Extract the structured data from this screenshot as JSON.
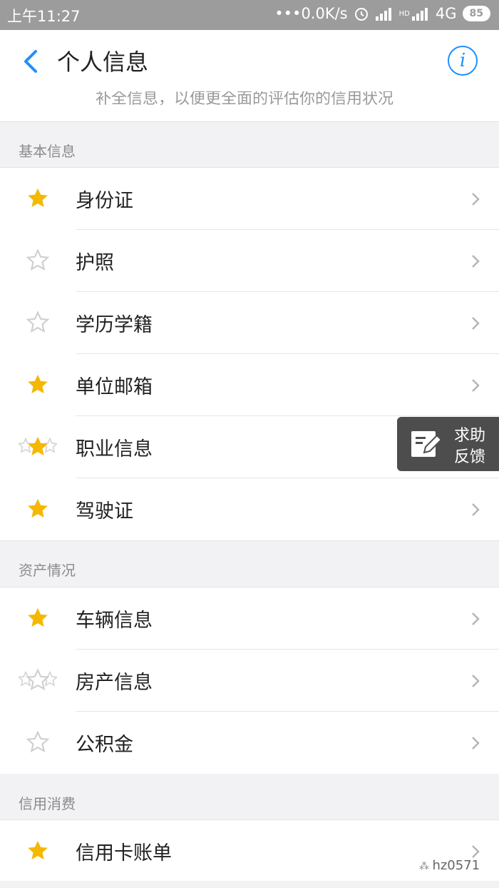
{
  "status": {
    "time": "上午11:27",
    "network": "•••0.0K/s",
    "signal_text": "4G",
    "hd": "HD",
    "battery": "85"
  },
  "nav": {
    "title": "个人信息",
    "info_icon": "info-icon"
  },
  "hint": "补全信息，以便更全面的评估你的信用状况",
  "sections": [
    {
      "label": "基本信息",
      "items": [
        {
          "label": "身份证",
          "star": "filled"
        },
        {
          "label": "护照",
          "star": "empty"
        },
        {
          "label": "学历学籍",
          "star": "empty"
        },
        {
          "label": "单位邮箱",
          "star": "filled"
        },
        {
          "label": "职业信息",
          "star": "multi-filled"
        },
        {
          "label": "驾驶证",
          "star": "filled"
        }
      ]
    },
    {
      "label": "资产情况",
      "items": [
        {
          "label": "车辆信息",
          "star": "filled"
        },
        {
          "label": "房产信息",
          "star": "multi-empty"
        },
        {
          "label": "公积金",
          "star": "empty"
        }
      ]
    },
    {
      "label": "信用消费",
      "items": [
        {
          "label": "信用卡账单",
          "star": "filled"
        }
      ]
    }
  ],
  "fab": {
    "line1": "求助",
    "line2": "反馈"
  },
  "watermark": "hz0571",
  "colors": {
    "star": "#f5b800",
    "accent": "#1e90ff",
    "statusbar": "#9c9c9c"
  }
}
